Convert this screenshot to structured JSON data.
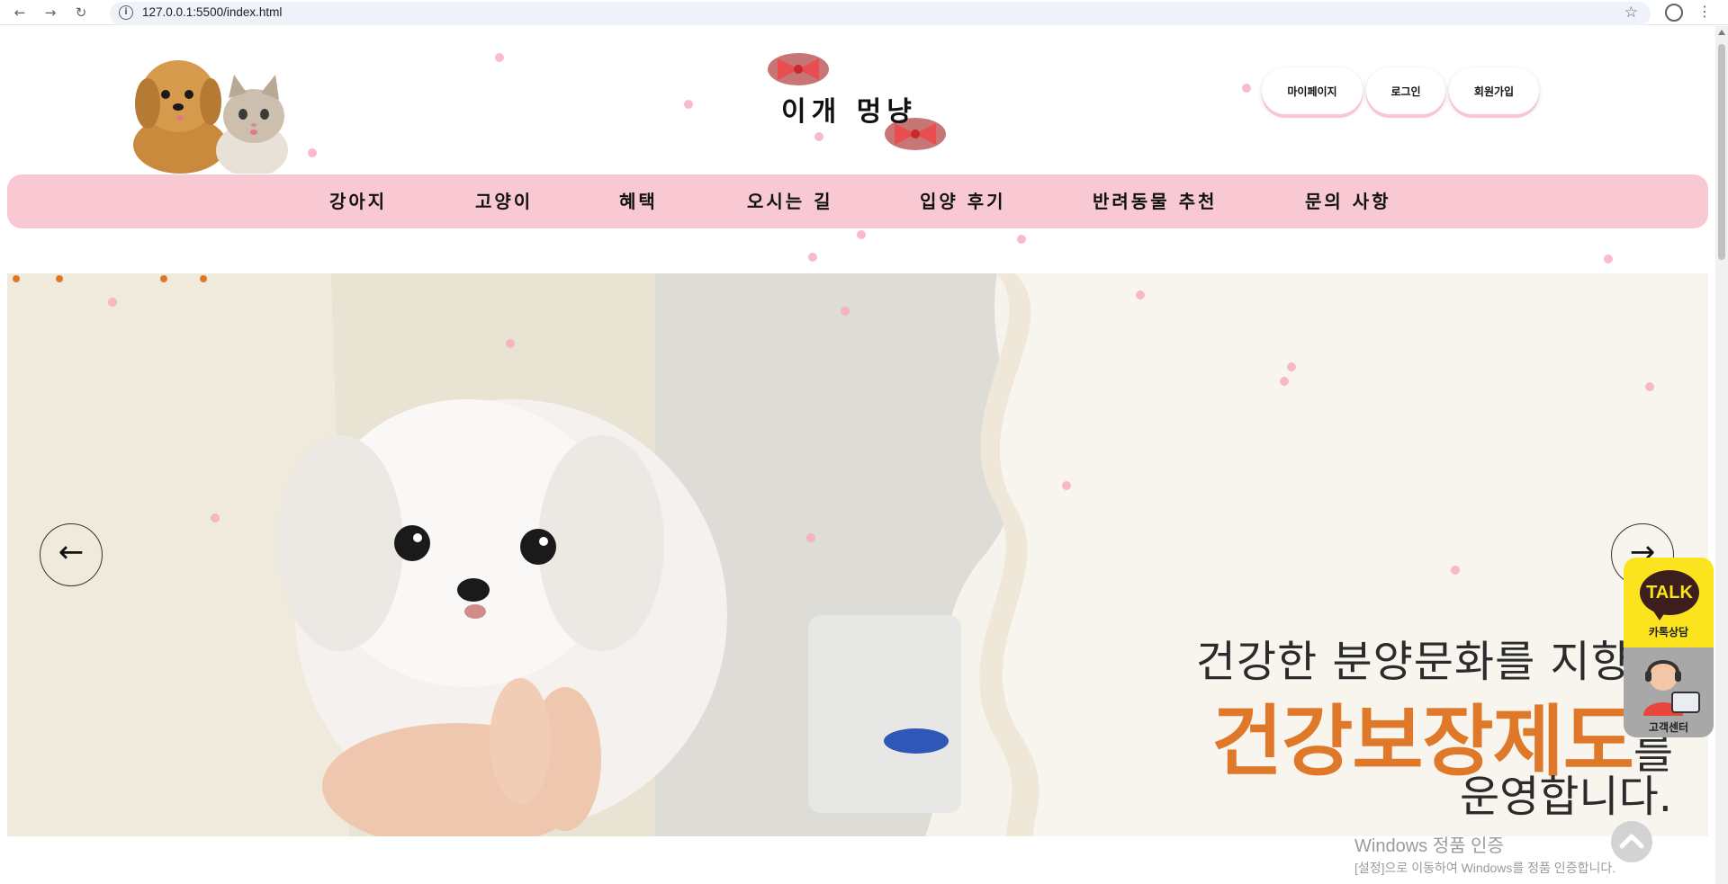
{
  "browser": {
    "url": "127.0.0.1:5500/index.html"
  },
  "header": {
    "site_title": "이개 멍냥",
    "buttons": [
      "마이페이지",
      "로그인",
      "회원가입"
    ]
  },
  "nav": {
    "items": [
      "강아지",
      "고양이",
      "혜택",
      "오시는 길",
      "입양 후기",
      "반려동물 추천",
      "문의 사항"
    ]
  },
  "hero": {
    "line1": "건강한 분양문화를 지향하",
    "line2_main": "건강보장제도",
    "line2_suffix": "를",
    "line3": "운영합니다.",
    "prev_arrow": "←",
    "next_arrow": "→"
  },
  "widgets": {
    "kakao_bubble": "TALK",
    "kakao_label": "카톡상담",
    "cs_label": "고객센터"
  },
  "windows_activation": {
    "title": "Windows 정품 인증",
    "subtitle": "[설정]으로 이동하여 Windows를 정품 인증합니다."
  },
  "colors": {
    "nav_bg": "#f8c8d3",
    "accent_orange": "#e0782a",
    "kakao_yellow": "#fbe41d"
  }
}
